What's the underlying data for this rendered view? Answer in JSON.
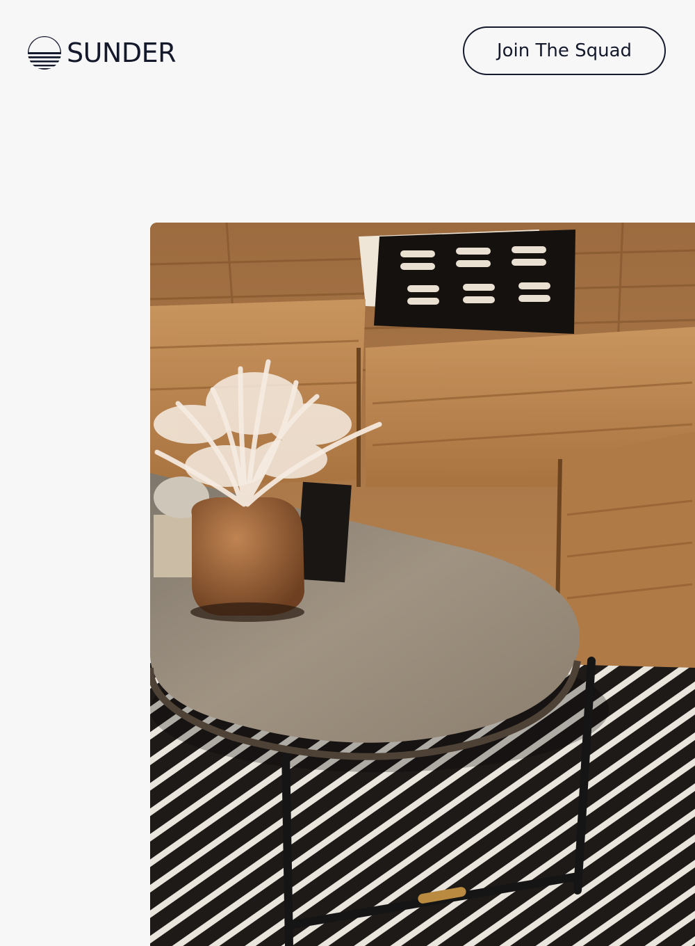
{
  "brand": {
    "name": "SUNDER",
    "logo_icon": "sunset-stripes-icon"
  },
  "header": {
    "cta_label": "Join The Squad"
  },
  "hero": {
    "image_subject": "living-room-photo",
    "colors": {
      "sofa": "#b8834f",
      "rug_dark": "#1e1a18",
      "rug_light": "#e9e4dc",
      "table": "#8e8070"
    }
  }
}
